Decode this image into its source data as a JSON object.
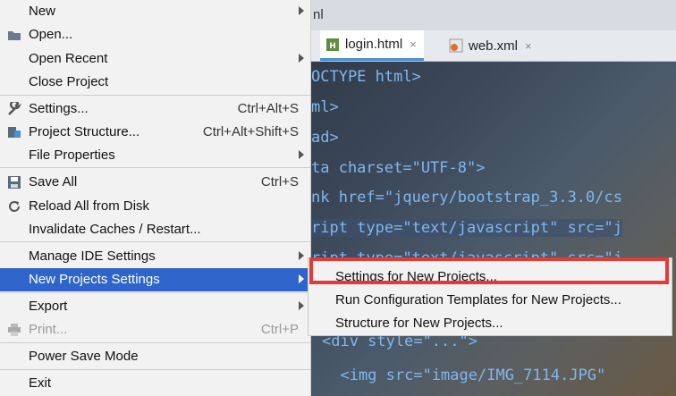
{
  "editor": {
    "topbar_text": "nl",
    "tabs": [
      {
        "label": "login.html",
        "close": "×"
      },
      {
        "label": "web.xml",
        "close": "×"
      }
    ],
    "code_lines": [
      "OCTYPE html>",
      "ml>",
      "ad>",
      "ta charset=\"UTF-8\">",
      "nk href=\"jquery/bootstrap_3.3.0/cs",
      "ript type=\"text/javascript\" src=\"j",
      "ript type=\"text/javascript\" src=\"j",
      "",
      "",
      "<div style=\"...\">",
      "  <img src=\"image/IMG_7114.JPG\""
    ]
  },
  "menu": {
    "items": [
      {
        "label": "New",
        "shortcut": "",
        "arrow": true
      },
      {
        "label": "Open...",
        "shortcut": "",
        "arrow": false
      },
      {
        "label": "Open Recent",
        "shortcut": "",
        "arrow": true
      },
      {
        "label": "Close Project",
        "shortcut": "",
        "arrow": false
      },
      {
        "label": "Settings...",
        "shortcut": "Ctrl+Alt+S",
        "arrow": false
      },
      {
        "label": "Project Structure...",
        "shortcut": "Ctrl+Alt+Shift+S",
        "arrow": false
      },
      {
        "label": "File Properties",
        "shortcut": "",
        "arrow": true
      },
      {
        "label": "Save All",
        "shortcut": "Ctrl+S",
        "arrow": false
      },
      {
        "label": "Reload All from Disk",
        "shortcut": "",
        "arrow": false
      },
      {
        "label": "Invalidate Caches / Restart...",
        "shortcut": "",
        "arrow": false
      },
      {
        "label": "Manage IDE Settings",
        "shortcut": "",
        "arrow": true
      },
      {
        "label": "New Projects Settings",
        "shortcut": "",
        "arrow": true
      },
      {
        "label": "Export",
        "shortcut": "",
        "arrow": true
      },
      {
        "label": "Print...",
        "shortcut": "Ctrl+P",
        "arrow": false
      },
      {
        "label": "Power Save Mode",
        "shortcut": "",
        "arrow": false
      },
      {
        "label": "Exit",
        "shortcut": "",
        "arrow": false
      }
    ]
  },
  "submenu": {
    "items": [
      {
        "label": "Settings for New Projects..."
      },
      {
        "label": "Run Configuration Templates for New Projects..."
      },
      {
        "label": "Structure for New Projects..."
      }
    ]
  },
  "colors": {
    "selection": "#2f65ca",
    "highlight_box": "#e53935"
  }
}
